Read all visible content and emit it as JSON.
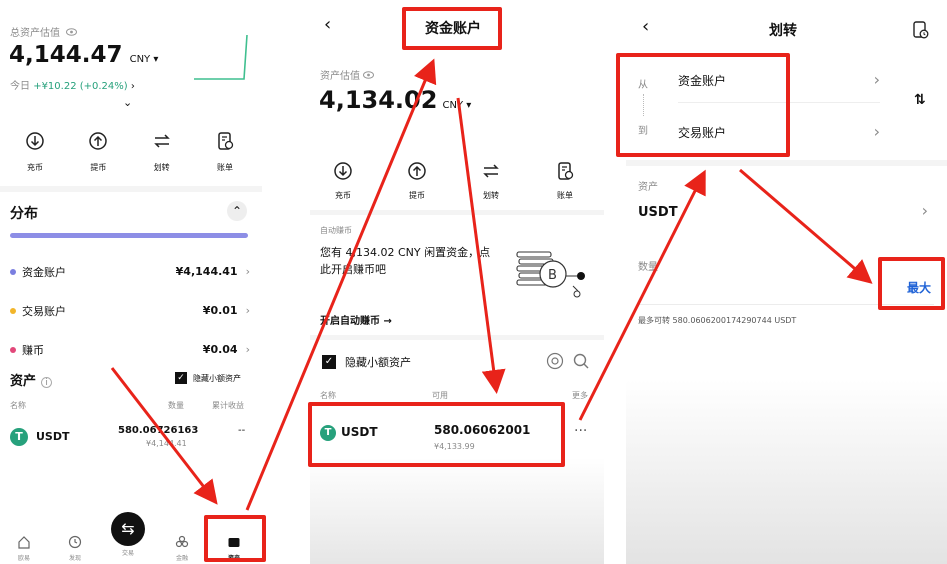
{
  "panel1": {
    "total_label": "总资产估值",
    "total_value": "4,144.47",
    "currency": "CNY",
    "today_label": "今日",
    "today_change": "+¥10.22 (+0.24%)",
    "actions": [
      {
        "label": "充币",
        "icon": "deposit-icon"
      },
      {
        "label": "提币",
        "icon": "withdraw-icon"
      },
      {
        "label": "划转",
        "icon": "transfer-icon"
      },
      {
        "label": "账单",
        "icon": "bill-icon"
      }
    ],
    "distribution_title": "分布",
    "accounts": [
      {
        "name": "资金账户",
        "value": "¥4,144.41",
        "color": "#7a7ee0"
      },
      {
        "name": "交易账户",
        "value": "¥0.01",
        "color": "#f2b52a"
      },
      {
        "name": "赚币",
        "value": "¥0.04",
        "color": "#e2487a"
      }
    ],
    "assets_title": "资产",
    "hide_small_label": "隐藏小额资产",
    "col_name": "名称",
    "col_qty": "数量",
    "col_earn": "累计收益",
    "asset": {
      "symbol": "USDT",
      "amount": "580.06726163",
      "cny": "¥4,144.41",
      "earn": "--"
    },
    "nav": [
      {
        "label": "欧易",
        "icon": "home-icon"
      },
      {
        "label": "发现",
        "icon": "discover-icon"
      },
      {
        "label": "交易",
        "icon": "trade-icon"
      },
      {
        "label": "金融",
        "icon": "finance-icon"
      },
      {
        "label": "资产",
        "icon": "wallet-icon"
      }
    ]
  },
  "panel2": {
    "title": "资金账户",
    "value_label": "资产估值",
    "value": "4,134.02",
    "currency": "CNY",
    "actions": [
      {
        "label": "充币",
        "icon": "deposit-icon"
      },
      {
        "label": "提币",
        "icon": "withdraw-icon"
      },
      {
        "label": "划转",
        "icon": "transfer-icon"
      },
      {
        "label": "账单",
        "icon": "bill-icon"
      }
    ],
    "auto_earn_label": "自动赚币",
    "auto_earn_text": "您有 4,134.02 CNY 闲置资金，点此开启赚币吧",
    "auto_earn_link": "开启自动赚币 →",
    "hide_small_label": "隐藏小额资产",
    "col_name": "名称",
    "col_avail": "可用",
    "col_more": "更多",
    "asset": {
      "symbol": "USDT",
      "amount": "580.06062001",
      "cny": "¥4,133.99"
    },
    "more_dots": "···"
  },
  "panel3": {
    "title": "划转",
    "from_label": "从",
    "to_label": "到",
    "from_account": "资金账户",
    "to_account": "交易账户",
    "asset_label": "资产",
    "asset_value": "USDT",
    "qty_label": "数量",
    "max_label": "最大",
    "max_available": "最多可转 580.0606200174290744 USDT"
  },
  "colors": {
    "accent_red": "#e8231a",
    "blue": "#1f62d6",
    "green_chart": "#27a17c"
  }
}
